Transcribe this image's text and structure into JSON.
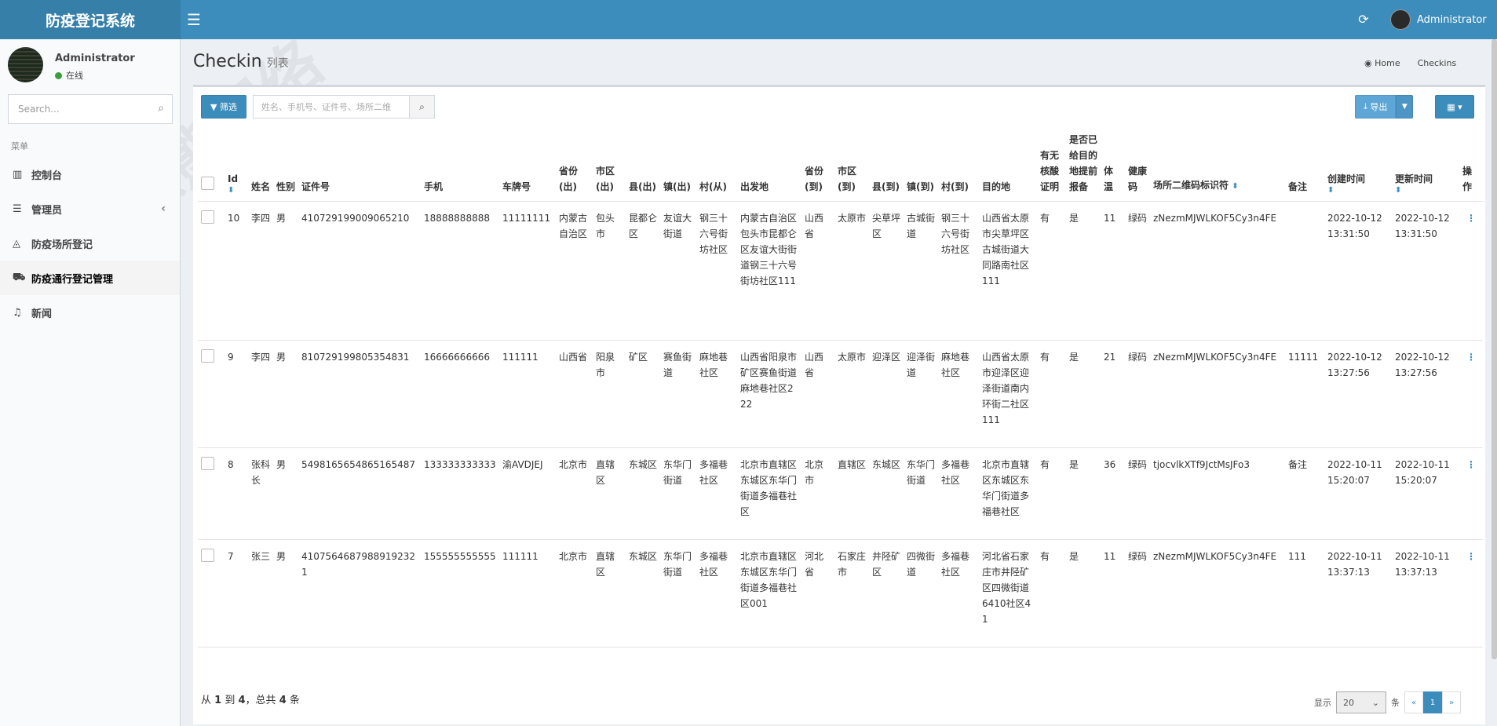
{
  "app": {
    "title": "防疫登记系统",
    "user": "Administrator"
  },
  "sidebar": {
    "user_name": "Administrator",
    "status": "在线",
    "search_placeholder": "Search...",
    "header": "菜单",
    "items": [
      {
        "label": "控制台",
        "icon": "bar-chart-icon"
      },
      {
        "label": "管理员",
        "icon": "list-icon"
      },
      {
        "label": "防疫场所登记",
        "icon": "area-chart-icon"
      },
      {
        "label": "防疫通行登记管理",
        "icon": "car-icon"
      },
      {
        "label": "新闻",
        "icon": "bell-icon"
      }
    ]
  },
  "page": {
    "title": "Checkin",
    "subtitle": "列表"
  },
  "breadcrumb": {
    "home": "Home",
    "current": "Checkins"
  },
  "toolbar": {
    "filter_label": "筛选",
    "search_placeholder": "姓名、手机号、证件号、场所二维",
    "export_label": "导出"
  },
  "table": {
    "columns": [
      "Id",
      "姓名",
      "性别",
      "证件号",
      "手机",
      "车牌号",
      "省份(出)",
      "市区(出)",
      "县(出)",
      "镇(出)",
      "村(从)",
      "出发地",
      "省份(到)",
      "市区(到)",
      "县(到)",
      "镇(到)",
      "村(到)",
      "目的地",
      "有无核酸证明",
      "是否已给目的地提前报备",
      "体温",
      "健康码",
      "场所二维码标识符",
      "备注",
      "创建时间",
      "更新时间",
      "操作"
    ],
    "rows": [
      [
        "10",
        "李四",
        "男",
        "410729199009065210",
        "18888888888",
        "11111111",
        "内蒙古自治区",
        "包头市",
        "昆都仑区",
        "友谊大街道",
        "钢三十六号街坊社区",
        "内蒙古自治区包头市昆都仑区友谊大街街道钢三十六号街坊社区111",
        "山西省",
        "太原市",
        "尖草坪区",
        "古城街道",
        "钢三十六号街坊社区",
        "山西省太原市尖草坪区古城街道大同路南社区111",
        "有",
        "是",
        "11",
        "绿码",
        "zNezmMJWLKOF5Cy3n4FE",
        "",
        "2022-10-12 13:31:50",
        "2022-10-12 13:31:50",
        "⋮"
      ],
      [
        "9",
        "李四",
        "男",
        "810729199805354831",
        "16666666666",
        "111111",
        "山西省",
        "阳泉市",
        "矿区",
        "赛鱼街道",
        "麻地巷社区",
        "山西省阳泉市矿区赛鱼街道麻地巷社区222",
        "山西省",
        "太原市",
        "迎泽区",
        "迎泽街道",
        "麻地巷社区",
        "山西省太原市迎泽区迎泽街道南内环街二社区111",
        "有",
        "是",
        "21",
        "绿码",
        "zNezmMJWLKOF5Cy3n4FE",
        "11111",
        "2022-10-12 13:27:56",
        "2022-10-12 13:27:56",
        "⋮"
      ],
      [
        "8",
        "张科长",
        "男",
        "5498165654865165487",
        "133333333333",
        "渝AVDJEJ",
        "北京市",
        "直辖区",
        "东城区",
        "东华门街道",
        "多福巷社区",
        "北京市直辖区东城区东华门街道多福巷社区",
        "北京市",
        "直辖区",
        "东城区",
        "东华门街道",
        "多福巷社区",
        "北京市直辖区东城区东华门街道多福巷社区",
        "有",
        "是",
        "36",
        "绿码",
        "tjocvlkXTf9JctMsJFo3",
        "备注",
        "2022-10-11 15:20:07",
        "2022-10-11 15:20:07",
        "⋮"
      ],
      [
        "7",
        "张三",
        "男",
        "41075646879889192321",
        "155555555555",
        "111111",
        "北京市",
        "直辖区",
        "东城区",
        "东华门街道",
        "多福巷社区",
        "北京市直辖区东城区东华门街道多福巷社区001",
        "河北省",
        "石家庄市",
        "井陉矿区",
        "四微街道",
        "多福巷社区",
        "河北省石家庄市井陉矿区四微街道6410社区41",
        "有",
        "是",
        "11",
        "绿码",
        "zNezmMJWLKOF5Cy3n4FE",
        "111",
        "2022-10-11 13:37:13",
        "2022-10-11 13:37:13",
        "⋮"
      ]
    ]
  },
  "footer": {
    "prefix": "从",
    "from": "1",
    "mid1": "到",
    "to": "4",
    "mid2": "，总共",
    "total": "4",
    "suffix": "条"
  },
  "pager": {
    "show_label": "显示",
    "page_size": "20",
    "unit": "条",
    "prev": "«",
    "current": "1",
    "next": "»"
  },
  "watermark": "怒熊网络"
}
